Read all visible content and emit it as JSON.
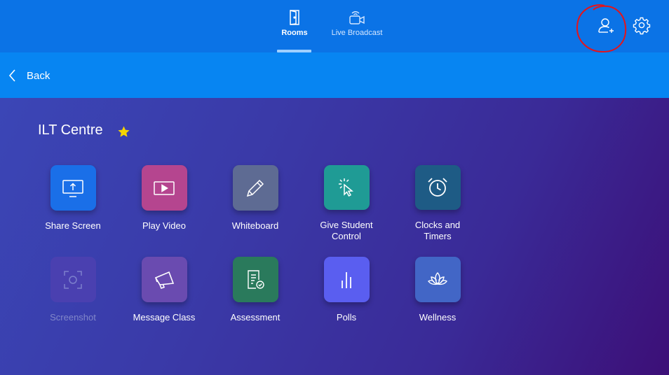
{
  "tabs": [
    {
      "label": "Rooms",
      "icon": "door-icon",
      "active": true
    },
    {
      "label": "Live Broadcast",
      "icon": "broadcast-camera-icon",
      "active": false
    }
  ],
  "header_icons": {
    "add_user": "add-user-icon",
    "settings": "gear-icon"
  },
  "back": {
    "label": "Back"
  },
  "room": {
    "title": "ILT Centre",
    "favorite": true
  },
  "colors": {
    "topbar": "#0b73e6",
    "backbar": "#0785f2",
    "star": "#f5d400",
    "annotation": "#e5141a"
  },
  "tools": [
    {
      "label": "Share Screen",
      "icon": "share-screen-icon",
      "color": "#1a6fe8",
      "disabled": false
    },
    {
      "label": "Play Video",
      "icon": "play-video-icon",
      "color": "#b5458f",
      "disabled": false
    },
    {
      "label": "Whiteboard",
      "icon": "pencil-icon",
      "color": "#5e6b93",
      "disabled": false
    },
    {
      "label": "Give Student\nControl",
      "icon": "pointer-click-icon",
      "color": "#1f9b95",
      "disabled": false
    },
    {
      "label": "Clocks and\nTimers",
      "icon": "alarm-clock-icon",
      "color": "#1e5b85",
      "disabled": false
    },
    {
      "label": "Screenshot",
      "icon": "screenshot-icon",
      "color": "#4a40b0",
      "disabled": true
    },
    {
      "label": "Message Class",
      "icon": "megaphone-icon",
      "color": "#6a4bb0",
      "disabled": false
    },
    {
      "label": "Assessment",
      "icon": "assessment-icon",
      "color": "#2a7a5c",
      "disabled": false
    },
    {
      "label": "Polls",
      "icon": "polls-icon",
      "color": "#5a5ef0",
      "disabled": false
    },
    {
      "label": "Wellness",
      "icon": "lotus-icon",
      "color": "#4266c6",
      "disabled": false
    }
  ]
}
